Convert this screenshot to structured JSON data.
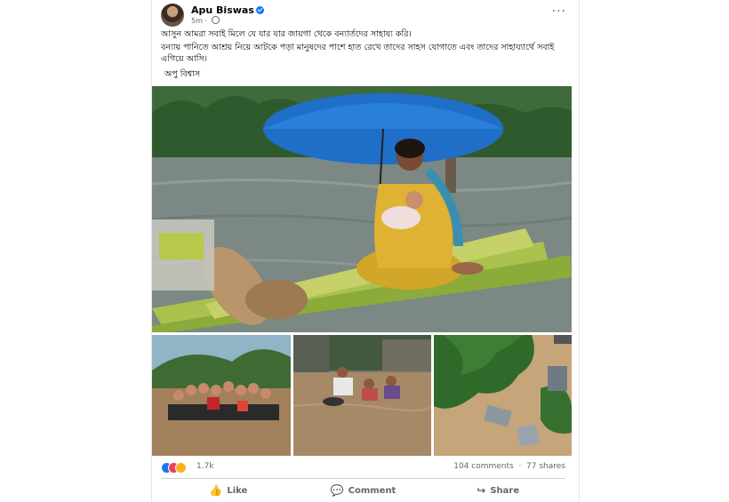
{
  "post": {
    "author": "Apu Biswas",
    "time": "5m",
    "caption_lines": [
      "আসুন আমরা সবাই মিলে যে যার যার জায়গা থেকে বন্যার্তদের সাহায্য করি।",
      "বন্যায় পানিতে আশ্রয় নিয়ে আটকে পড়া মানুষদের পাশে হাত রেখে তাদের সাহস যোগাতে এবং তাদের সাহায্যার্থে সবাই এগিয়ে আসি।"
    ],
    "signature": "অপু বিশ্বাস"
  },
  "stats": {
    "reactions_count": "1.7k",
    "comments": "104 comments",
    "shares": "77 shares"
  },
  "actions": {
    "like": "Like",
    "comment": "Comment",
    "share": "Share"
  },
  "icons": [
    "avatar",
    "verified-badge-icon",
    "globe-icon",
    "more-options-icon",
    "like-icon",
    "comment-icon",
    "share-icon"
  ],
  "colors": {
    "accent": "#1877f2",
    "muted_text": "#65676b",
    "divider": "#ced0d4"
  }
}
